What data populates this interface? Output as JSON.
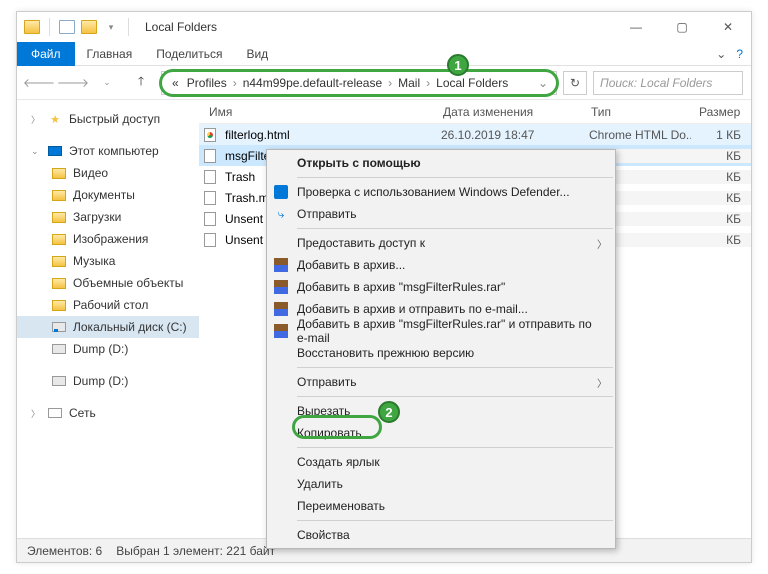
{
  "titlebar": {
    "title": "Local Folders"
  },
  "ribbon": {
    "file": "Файл",
    "tabs": [
      "Главная",
      "Поделиться",
      "Вид"
    ]
  },
  "breadcrumb": {
    "items": [
      "Profiles",
      "n44m99pe.default-release",
      "Mail",
      "Local Folders"
    ]
  },
  "search": {
    "placeholder": "Поиск: Local Folders"
  },
  "columns": {
    "name": "Имя",
    "date": "Дата изменения",
    "type": "Тип",
    "size": "Размер"
  },
  "sidebar": {
    "quick": "Быстрый доступ",
    "pc": "Этот компьютер",
    "children": [
      "Видео",
      "Документы",
      "Загрузки",
      "Изображения",
      "Музыка",
      "Объемные объекты",
      "Рабочий стол"
    ],
    "drives": [
      "Локальный диск (C:)",
      "Dump (D:)",
      "Dump (D:)"
    ],
    "network": "Сеть"
  },
  "files": [
    {
      "name": "filterlog.html",
      "date": "26.10.2019 18:47",
      "type": "Chrome HTML Do...",
      "size": "1 КБ",
      "icon": "chrome"
    },
    {
      "name": "msgFilterRules.dat",
      "date": "",
      "type": "",
      "size": "КБ",
      "icon": "doc"
    },
    {
      "name": "Trash",
      "date": "",
      "type": "",
      "size": "КБ",
      "icon": "doc"
    },
    {
      "name": "Trash.msf",
      "date": "",
      "type": "",
      "size": "КБ",
      "icon": "doc"
    },
    {
      "name": "Unsent Messages",
      "date": "",
      "type": "",
      "size": "КБ",
      "icon": "doc"
    },
    {
      "name": "Unsent Messages.",
      "date": "",
      "type": "",
      "size": "КБ",
      "icon": "doc"
    }
  ],
  "context_menu": {
    "open_with": "Открыть с помощью",
    "defender": "Проверка с использованием Windows Defender...",
    "send1": "Отправить",
    "share_access": "Предоставить доступ к",
    "add_archive": "Добавить в архив...",
    "add_rar": "Добавить в архив \"msgFilterRules.rar\"",
    "add_email": "Добавить в архив и отправить по e-mail...",
    "add_rar_email": "Добавить в архив \"msgFilterRules.rar\" и отправить по e-mail",
    "restore": "Восстановить прежнюю версию",
    "send_to": "Отправить",
    "cut": "Вырезать",
    "copy": "Копировать",
    "shortcut": "Создать ярлык",
    "delete": "Удалить",
    "rename": "Переименовать",
    "properties": "Свойства"
  },
  "statusbar": {
    "count": "Элементов: 6",
    "selection": "Выбран 1 элемент: 221 байт"
  },
  "annotations": {
    "n1": "1",
    "n2": "2"
  }
}
